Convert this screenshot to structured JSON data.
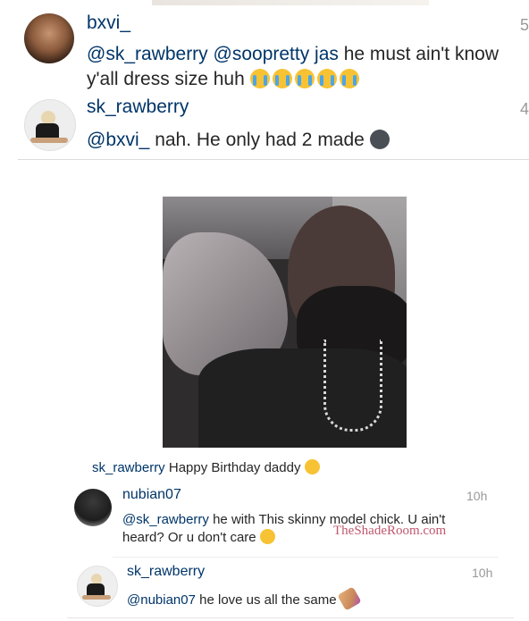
{
  "top_comments": [
    {
      "username": "bxvi_",
      "mentions": "@sk_rawberry @soopretty jas",
      "text": "he must ain't know y'all dress size huh",
      "time": "5"
    },
    {
      "username": "sk_rawberry",
      "mentions": "@bxvi_",
      "text": "nah. He only had 2 made",
      "time": "4"
    }
  ],
  "post": {
    "caption_user": "sk_rawberry",
    "caption_text": "Happy Birthday daddy"
  },
  "bottom_comments": [
    {
      "username": "nubian07",
      "time": "10h",
      "mention": "@sk_rawberry",
      "text": "he with This skinny model chick. U ain't heard? Or u don't care"
    },
    {
      "username": "sk_rawberry",
      "time": "10h",
      "mention": "@nubian07",
      "text": "he love us all the same"
    }
  ],
  "watermark": "TheShadeRoom.com",
  "colors": {
    "username": "#003569",
    "text": "#262626",
    "meta": "#999999"
  }
}
